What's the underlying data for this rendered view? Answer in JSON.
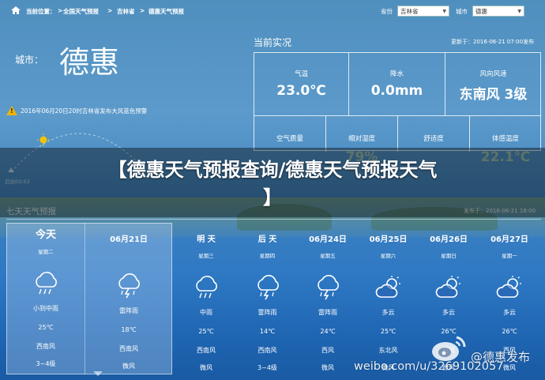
{
  "breadcrumb": {
    "prefix": "当前位置：",
    "items": [
      "全国天气预报",
      "吉林省",
      "德惠天气预报"
    ],
    "separator": ">"
  },
  "selectors": {
    "province_label": "省份",
    "province_value": "吉林省",
    "city_label": "城市",
    "city_value": "德惠"
  },
  "city": {
    "label": "城市：",
    "name": "德惠"
  },
  "warning": {
    "text": "2016年06月20日20时吉林省发布大风蓝色预警"
  },
  "sun": {
    "sunrise": "日出03:53"
  },
  "current": {
    "title": "当前实况",
    "update": "更新于：2016-06-21 07:00发布",
    "row1": [
      {
        "key": "气温",
        "value": "23.0℃"
      },
      {
        "key": "降水",
        "value": "0.0mm"
      },
      {
        "key": "风向风速",
        "value": "东南风 3级"
      }
    ],
    "row2": [
      {
        "key": "空气质量",
        "value": ""
      },
      {
        "key": "相对湿度",
        "value": "79%"
      },
      {
        "key": "舒适度",
        "value": ""
      },
      {
        "key": "体感温度",
        "value": "22.1℃"
      }
    ]
  },
  "forecast": {
    "title": "七天天气预报",
    "update": "发布于：2016-06-21 18:00",
    "days": [
      {
        "name": "今天",
        "weekday": "星期二",
        "desc": "小到中雨",
        "temp": "25℃",
        "wind_dir": "西南风",
        "wind_lvl": "3~4级",
        "icon": "rain-icon"
      },
      {
        "name": "06月21日",
        "weekday": "",
        "desc": "雷阵雨",
        "temp": "18℃",
        "wind_dir": "西南风",
        "wind_lvl": "微风",
        "icon": "thunderstorm-icon"
      },
      {
        "name": "明 天",
        "weekday": "星期三",
        "desc": "中雨",
        "temp": "25℃",
        "wind_dir": "西南风",
        "wind_lvl": "微风",
        "icon": "rain-icon"
      },
      {
        "name": "后 天",
        "weekday": "星期四",
        "desc": "雷阵雨",
        "temp": "14℃",
        "wind_dir": "西南风",
        "wind_lvl": "3~4级",
        "icon": "thunderstorm-icon"
      },
      {
        "name": "06月24日",
        "weekday": "星期五",
        "desc": "雷阵雨",
        "temp": "24℃",
        "wind_dir": "西风",
        "wind_lvl": "微风",
        "icon": "thunderstorm-icon"
      },
      {
        "name": "06月25日",
        "weekday": "星期六",
        "desc": "多云",
        "temp": "25℃",
        "wind_dir": "东北风",
        "wind_lvl": "微风",
        "icon": "partly-cloudy-icon"
      },
      {
        "name": "06月26日",
        "weekday": "星期日",
        "desc": "多云",
        "temp": "26℃",
        "wind_dir": "西风",
        "wind_lvl": "微风",
        "icon": "partly-cloudy-icon"
      },
      {
        "name": "06月27日",
        "weekday": "星期一",
        "desc": "多云",
        "temp": "26℃",
        "wind_dir": "西风",
        "wind_lvl": "微风",
        "icon": "partly-cloudy-icon"
      }
    ]
  },
  "banner": {
    "line1": "【德惠天气预报查询/德惠天气预报天气",
    "line2": "】"
  },
  "watermark": {
    "handle": "@德惠发布",
    "url": "weibo.com/u/3269102057"
  },
  "colors": {
    "warning": "#f0b400",
    "sun": "#f5c400"
  }
}
